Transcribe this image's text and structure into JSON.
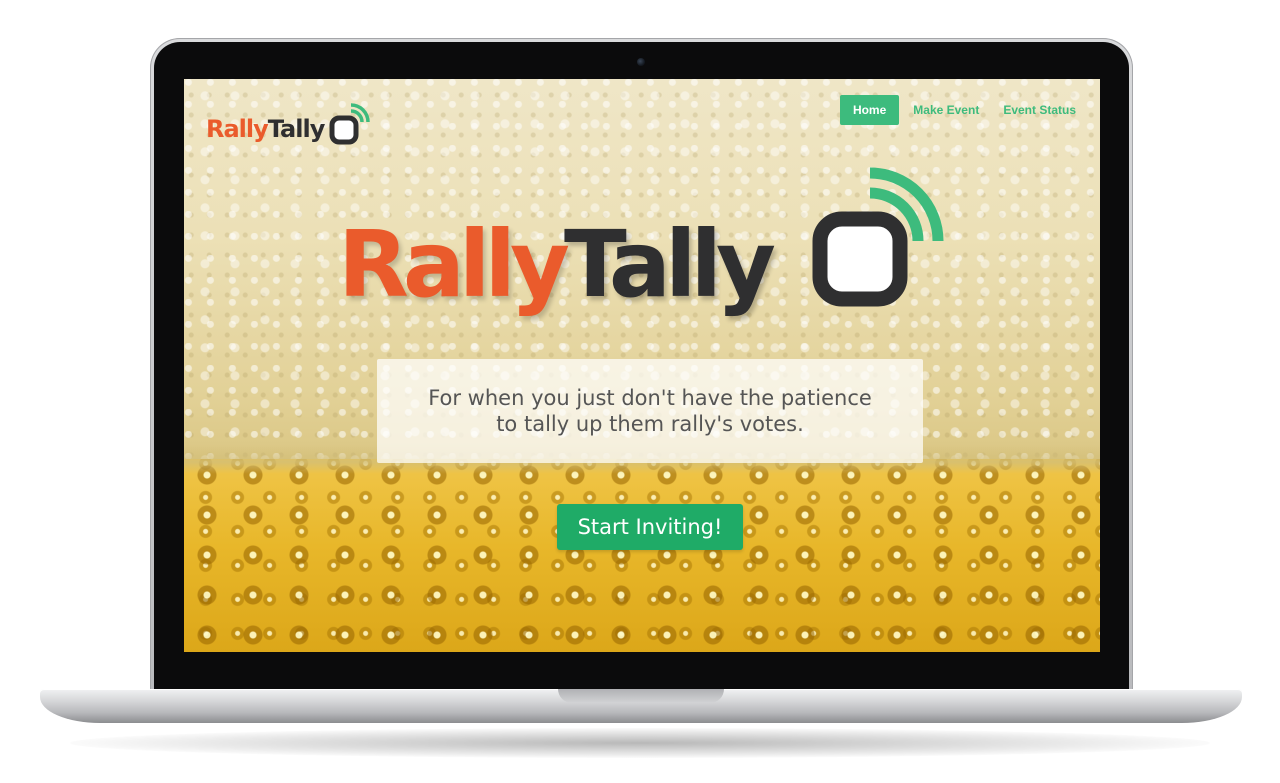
{
  "brand": {
    "name_part1": "Rally",
    "name_part2": "Tally",
    "logo_icon": "signal-box-icon",
    "colors": {
      "rally_orange": "#ea5b2c",
      "tally_dark": "#2f2f30",
      "accent_green": "#3dbb7d",
      "cta_green": "#1fab67"
    }
  },
  "nav": {
    "items": [
      {
        "label": "Home",
        "active": true
      },
      {
        "label": "Make Event",
        "active": false
      },
      {
        "label": "Event Status",
        "active": false
      }
    ]
  },
  "hero": {
    "tagline": "For when you just don't have the patience to tally up them rally's votes.",
    "cta_label": "Start Inviting!"
  }
}
